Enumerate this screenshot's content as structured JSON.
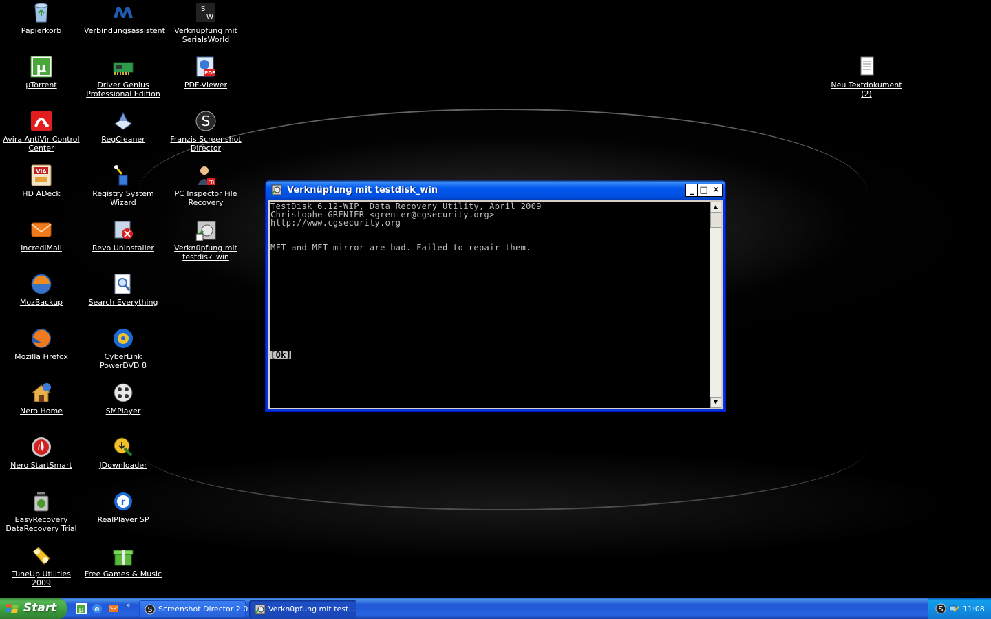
{
  "desktop": {
    "icons": [
      {
        "id": "papierkorb",
        "label": "Papierkorb",
        "icon": "recycle-bin-icon"
      },
      {
        "id": "verbindungsassistent",
        "label": "Verbindungsassistent",
        "icon": "network-wizard-icon"
      },
      {
        "id": "serialsworld",
        "label": "Verknüpfung mit SerialsWorld",
        "icon": "serialsworld-icon"
      },
      {
        "id": "utorrent",
        "label": "µTorrent",
        "icon": "utorrent-icon"
      },
      {
        "id": "driver-genius",
        "label": "Driver Genius Professional Edition",
        "icon": "driver-card-icon"
      },
      {
        "id": "pdf-viewer",
        "label": "PDF-Viewer",
        "icon": "pdf-icon"
      },
      {
        "id": "avira",
        "label": "Avira AntiVir Control Center",
        "icon": "avira-umbrella-icon"
      },
      {
        "id": "regcleaner",
        "label": "RegCleaner",
        "icon": "regcleaner-icon"
      },
      {
        "id": "franzis",
        "label": "Franzis Screenshot Director",
        "icon": "screenshot-director-icon"
      },
      {
        "id": "hd-adeck",
        "label": "HD ADeck",
        "icon": "hd-adeck-icon"
      },
      {
        "id": "registry-wizard",
        "label": "Registry System Wizard",
        "icon": "wizard-icon"
      },
      {
        "id": "pc-inspector",
        "label": "PC Inspector File Recovery",
        "icon": "pc-inspector-icon"
      },
      {
        "id": "incredimail",
        "label": "IncrediMail",
        "icon": "mail-envelope-icon"
      },
      {
        "id": "revo",
        "label": "Revo Uninstaller",
        "icon": "revo-uninstaller-icon"
      },
      {
        "id": "testdisk",
        "label": "Verknüpfung mit testdisk_win",
        "icon": "testdisk-shortcut-icon"
      },
      {
        "id": "mozbackup",
        "label": "MozBackup",
        "icon": "mozbackup-icon"
      },
      {
        "id": "search-everything",
        "label": "Search Everything",
        "icon": "search-document-icon"
      },
      {
        "id": "firefox",
        "label": "Mozilla Firefox",
        "icon": "firefox-icon"
      },
      {
        "id": "powerdvd",
        "label": "CyberLink PowerDVD 8",
        "icon": "powerdvd-icon"
      },
      {
        "id": "nero-home",
        "label": "Nero Home",
        "icon": "nero-home-icon"
      },
      {
        "id": "smplayer",
        "label": "SMPlayer",
        "icon": "smplayer-icon"
      },
      {
        "id": "nero-startsmart",
        "label": "Nero StartSmart",
        "icon": "nero-flame-icon"
      },
      {
        "id": "jdownloader",
        "label": "JDownloader",
        "icon": "jdownloader-icon"
      },
      {
        "id": "easyrecovery",
        "label": "EasyRecovery DataRecovery Trial",
        "icon": "easyrecovery-icon"
      },
      {
        "id": "realplayer",
        "label": "RealPlayer SP",
        "icon": "realplayer-icon"
      },
      {
        "id": "tuneup",
        "label": "TuneUp Utilities 2009",
        "icon": "tuneup-icon"
      },
      {
        "id": "free-games",
        "label": "Free Games & Music",
        "icon": "gift-box-icon"
      },
      {
        "id": "neu-text",
        "label": "Neu Textdokument (2)",
        "icon": "text-document-icon"
      }
    ]
  },
  "window": {
    "title": "Verknüpfung mit testdisk_win",
    "minimize": "_",
    "maximize": "□",
    "close": "✕",
    "console": {
      "line1": "TestDisk 6.12-WIP, Data Recovery Utility, April 2009",
      "line2": "Christophe GRENIER <grenier@cgsecurity.org>",
      "line3": "http://www.cgsecurity.org",
      "message": "MFT and MFT mirror are bad. Failed to repair them.",
      "ok": "[Ok]"
    }
  },
  "taskbar": {
    "start": "Start",
    "tasks": [
      {
        "label": "Screenshot Director 2.0",
        "icon": "screenshot-director-icon"
      },
      {
        "label": "Verknüpfung mit test...",
        "icon": "testdisk-shortcut-icon"
      }
    ],
    "chevron": "»",
    "clock": "11:08"
  },
  "colors": {
    "taskbar_blue": "#2663e0",
    "start_green": "#3a9d3a",
    "titlebar_blue": "#0058ee",
    "console_text": "#c0c0c0"
  }
}
